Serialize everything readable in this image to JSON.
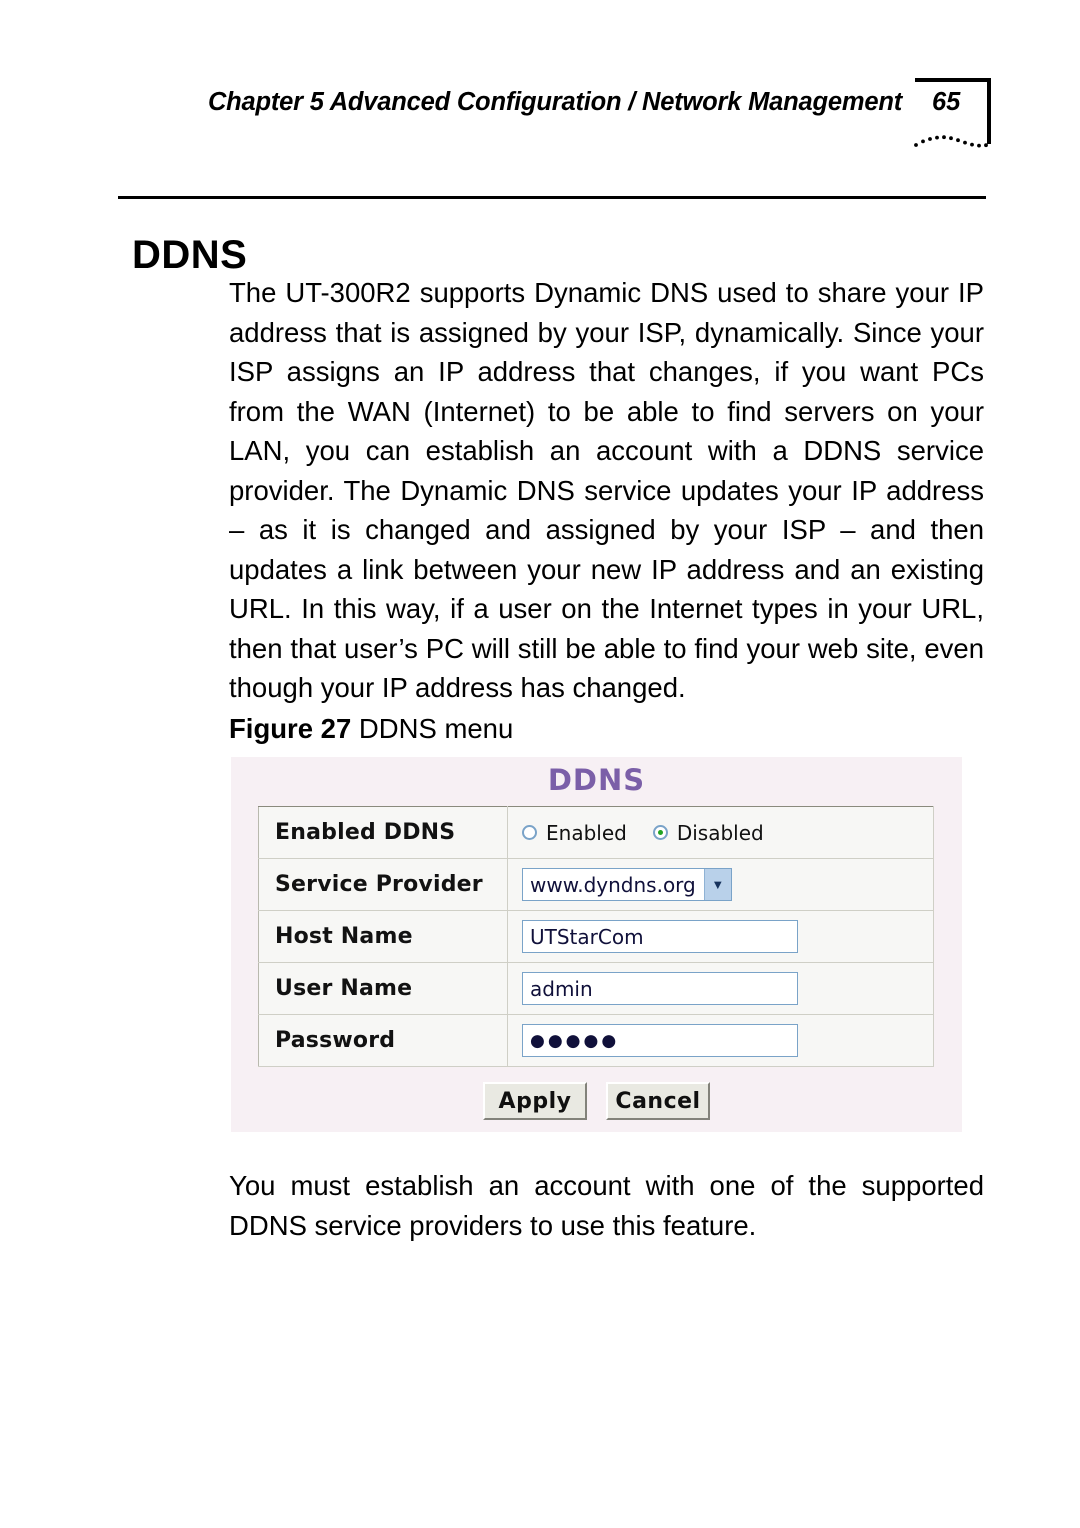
{
  "header": {
    "running_title": "Chapter 5 Advanced Configuration / Network Management",
    "page_number": "65"
  },
  "section": {
    "title": "DDNS"
  },
  "body": {
    "intro_paragraph": "The UT-300R2 supports Dynamic DNS used to share your IP address that is assigned by your ISP, dynamically. Since your ISP assigns an IP address that changes, if you want PCs from the WAN (Internet) to be able to find servers on your LAN, you can establish an account with a DDNS service provider. The Dynamic DNS service updates your IP address – as it is changed and assigned by your ISP – and then updates a link between your new IP address and an existing URL. In this way, if a user on the Internet types in your URL, then that user’s PC will still be able to find your web site, even though your IP address has changed.",
    "closing_paragraph": "You must establish an account with one of the supported DDNS service providers to use this feature."
  },
  "figure": {
    "caption_label": "Figure 27",
    "caption_text": " DDNS menu",
    "screenshot": {
      "title": "DDNS",
      "title_color": "#7b5fa8",
      "background_color": "#f7f0f4",
      "rows": [
        {
          "label": "Enabled DDNS",
          "type": "radio",
          "options": [
            {
              "label": "Enabled",
              "selected": false
            },
            {
              "label": "Disabled",
              "selected": true
            }
          ],
          "selected_color": "#22a322"
        },
        {
          "label": "Service Provider",
          "type": "select",
          "value": "www.dyndns.org",
          "arrow_icon": "chevron-down-icon"
        },
        {
          "label": "Host Name",
          "type": "text",
          "value": "UTStarCom"
        },
        {
          "label": "User Name",
          "type": "text",
          "value": "admin"
        },
        {
          "label": "Password",
          "type": "password",
          "value": "●●●●●"
        }
      ],
      "buttons": [
        {
          "label": "Apply"
        },
        {
          "label": "Cancel"
        }
      ]
    }
  }
}
